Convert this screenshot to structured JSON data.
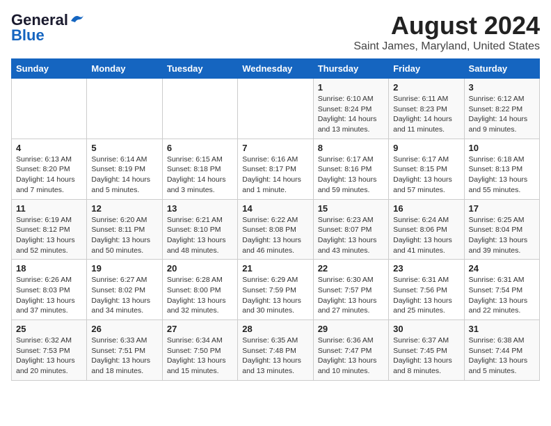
{
  "logo": {
    "line1": "General",
    "line2": "Blue"
  },
  "title": "August 2024",
  "subtitle": "Saint James, Maryland, United States",
  "days_of_week": [
    "Sunday",
    "Monday",
    "Tuesday",
    "Wednesday",
    "Thursday",
    "Friday",
    "Saturday"
  ],
  "weeks": [
    [
      {
        "day": "",
        "info": ""
      },
      {
        "day": "",
        "info": ""
      },
      {
        "day": "",
        "info": ""
      },
      {
        "day": "",
        "info": ""
      },
      {
        "day": "1",
        "info": "Sunrise: 6:10 AM\nSunset: 8:24 PM\nDaylight: 14 hours\nand 13 minutes."
      },
      {
        "day": "2",
        "info": "Sunrise: 6:11 AM\nSunset: 8:23 PM\nDaylight: 14 hours\nand 11 minutes."
      },
      {
        "day": "3",
        "info": "Sunrise: 6:12 AM\nSunset: 8:22 PM\nDaylight: 14 hours\nand 9 minutes."
      }
    ],
    [
      {
        "day": "4",
        "info": "Sunrise: 6:13 AM\nSunset: 8:20 PM\nDaylight: 14 hours\nand 7 minutes."
      },
      {
        "day": "5",
        "info": "Sunrise: 6:14 AM\nSunset: 8:19 PM\nDaylight: 14 hours\nand 5 minutes."
      },
      {
        "day": "6",
        "info": "Sunrise: 6:15 AM\nSunset: 8:18 PM\nDaylight: 14 hours\nand 3 minutes."
      },
      {
        "day": "7",
        "info": "Sunrise: 6:16 AM\nSunset: 8:17 PM\nDaylight: 14 hours\nand 1 minute."
      },
      {
        "day": "8",
        "info": "Sunrise: 6:17 AM\nSunset: 8:16 PM\nDaylight: 13 hours\nand 59 minutes."
      },
      {
        "day": "9",
        "info": "Sunrise: 6:17 AM\nSunset: 8:15 PM\nDaylight: 13 hours\nand 57 minutes."
      },
      {
        "day": "10",
        "info": "Sunrise: 6:18 AM\nSunset: 8:13 PM\nDaylight: 13 hours\nand 55 minutes."
      }
    ],
    [
      {
        "day": "11",
        "info": "Sunrise: 6:19 AM\nSunset: 8:12 PM\nDaylight: 13 hours\nand 52 minutes."
      },
      {
        "day": "12",
        "info": "Sunrise: 6:20 AM\nSunset: 8:11 PM\nDaylight: 13 hours\nand 50 minutes."
      },
      {
        "day": "13",
        "info": "Sunrise: 6:21 AM\nSunset: 8:10 PM\nDaylight: 13 hours\nand 48 minutes."
      },
      {
        "day": "14",
        "info": "Sunrise: 6:22 AM\nSunset: 8:08 PM\nDaylight: 13 hours\nand 46 minutes."
      },
      {
        "day": "15",
        "info": "Sunrise: 6:23 AM\nSunset: 8:07 PM\nDaylight: 13 hours\nand 43 minutes."
      },
      {
        "day": "16",
        "info": "Sunrise: 6:24 AM\nSunset: 8:06 PM\nDaylight: 13 hours\nand 41 minutes."
      },
      {
        "day": "17",
        "info": "Sunrise: 6:25 AM\nSunset: 8:04 PM\nDaylight: 13 hours\nand 39 minutes."
      }
    ],
    [
      {
        "day": "18",
        "info": "Sunrise: 6:26 AM\nSunset: 8:03 PM\nDaylight: 13 hours\nand 37 minutes."
      },
      {
        "day": "19",
        "info": "Sunrise: 6:27 AM\nSunset: 8:02 PM\nDaylight: 13 hours\nand 34 minutes."
      },
      {
        "day": "20",
        "info": "Sunrise: 6:28 AM\nSunset: 8:00 PM\nDaylight: 13 hours\nand 32 minutes."
      },
      {
        "day": "21",
        "info": "Sunrise: 6:29 AM\nSunset: 7:59 PM\nDaylight: 13 hours\nand 30 minutes."
      },
      {
        "day": "22",
        "info": "Sunrise: 6:30 AM\nSunset: 7:57 PM\nDaylight: 13 hours\nand 27 minutes."
      },
      {
        "day": "23",
        "info": "Sunrise: 6:31 AM\nSunset: 7:56 PM\nDaylight: 13 hours\nand 25 minutes."
      },
      {
        "day": "24",
        "info": "Sunrise: 6:31 AM\nSunset: 7:54 PM\nDaylight: 13 hours\nand 22 minutes."
      }
    ],
    [
      {
        "day": "25",
        "info": "Sunrise: 6:32 AM\nSunset: 7:53 PM\nDaylight: 13 hours\nand 20 minutes."
      },
      {
        "day": "26",
        "info": "Sunrise: 6:33 AM\nSunset: 7:51 PM\nDaylight: 13 hours\nand 18 minutes."
      },
      {
        "day": "27",
        "info": "Sunrise: 6:34 AM\nSunset: 7:50 PM\nDaylight: 13 hours\nand 15 minutes."
      },
      {
        "day": "28",
        "info": "Sunrise: 6:35 AM\nSunset: 7:48 PM\nDaylight: 13 hours\nand 13 minutes."
      },
      {
        "day": "29",
        "info": "Sunrise: 6:36 AM\nSunset: 7:47 PM\nDaylight: 13 hours\nand 10 minutes."
      },
      {
        "day": "30",
        "info": "Sunrise: 6:37 AM\nSunset: 7:45 PM\nDaylight: 13 hours\nand 8 minutes."
      },
      {
        "day": "31",
        "info": "Sunrise: 6:38 AM\nSunset: 7:44 PM\nDaylight: 13 hours\nand 5 minutes."
      }
    ]
  ]
}
